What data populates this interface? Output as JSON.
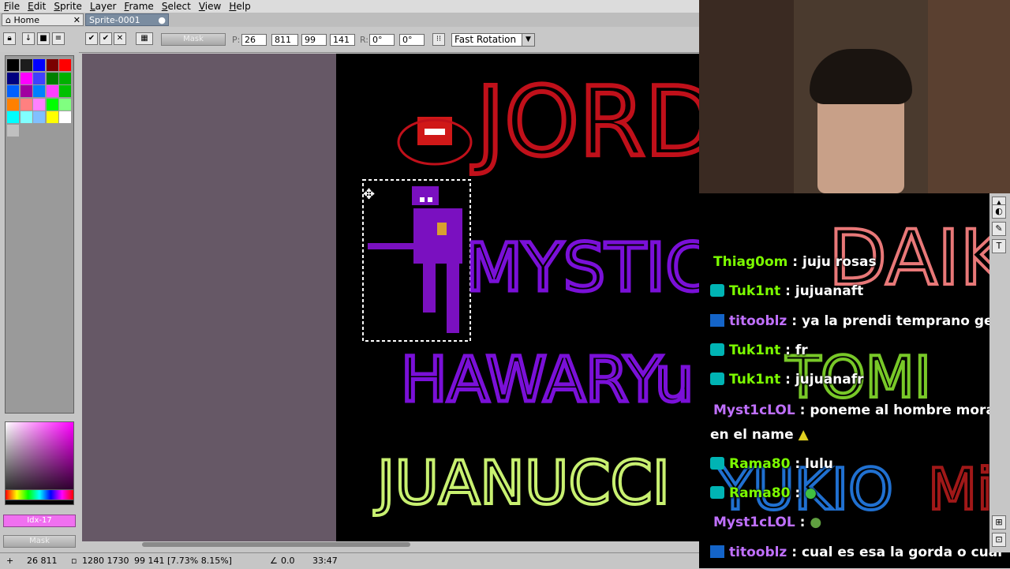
{
  "menu": [
    "File",
    "Edit",
    "Sprite",
    "Layer",
    "Frame",
    "Select",
    "View",
    "Help"
  ],
  "tabs": {
    "home": "Home",
    "sprite": "Sprite-0001"
  },
  "toolbar": {
    "mask_label": "Mask",
    "p_label": "P:",
    "x": "26",
    "y": "811",
    "w": "99",
    "h": "141",
    "r_label": "R:",
    "r1": "0°",
    "r2": "0°",
    "rotation": "Fast Rotation"
  },
  "palette": {
    "colors": [
      "#000000",
      "#1c1c1c",
      "#0000ff",
      "#7a0000",
      "#ff0000",
      "#000080",
      "#ff00ff",
      "#4040ff",
      "#008000",
      "#00b000",
      "#0060ff",
      "#a000a0",
      "#0080ff",
      "#ff40ff",
      "#00c000",
      "#ff8000",
      "#ff8080",
      "#ff80ff",
      "#00ff00",
      "#80ff80",
      "#00ffff",
      "#80ffff",
      "#80c0ff",
      "#ffff00",
      "#ffffff",
      "#c0c0c0"
    ]
  },
  "left": {
    "index_label": "Idx-17",
    "mask_label": "Mask"
  },
  "status": {
    "cursor": "26 811",
    "size": "1280 1730",
    "selection": "99 141 [7.73% 8.15%]",
    "angle": "0.0",
    "time": "33:47"
  },
  "canvas_text": {
    "name1": "JORD",
    "name2": "MYSTICLOL",
    "name3": "HAWARYu",
    "name4": "JUANUCCI",
    "name5": "DAIK",
    "name6": "TOMI",
    "name7": "YUKIO",
    "name8": "Mi"
  },
  "chat": [
    {
      "user": "Thiag0om",
      "badge": "",
      "color": "#7cfc00",
      "msg": "juju rosas"
    },
    {
      "user": "Tuk1nt",
      "badge": "mod",
      "color": "#7cfc00",
      "msg": "jujuanaft"
    },
    {
      "user": "titooblz",
      "badge": "vip",
      "color": "#c070ff",
      "msg": "ya la prendi temprano ged"
    },
    {
      "user": "Tuk1nt",
      "badge": "mod",
      "color": "#7cfc00",
      "msg": "fr"
    },
    {
      "user": "Tuk1nt",
      "badge": "mod",
      "color": "#7cfc00",
      "msg": "jujuanafr"
    },
    {
      "user": "Myst1cLOL",
      "badge": "",
      "color": "#c070ff",
      "msg": "poneme al hombre morado"
    },
    {
      "user": "",
      "badge": "",
      "color": "#ffffff",
      "msg": "en el name"
    },
    {
      "user": "Rama80",
      "badge": "mod",
      "color": "#7cfc00",
      "msg": "lulu"
    },
    {
      "user": "Rama80",
      "badge": "mod",
      "color": "#7cfc00",
      "msg": ""
    },
    {
      "user": "Myst1cLOL",
      "badge": "",
      "color": "#c070ff",
      "msg": ""
    },
    {
      "user": "titooblz",
      "badge": "vip",
      "color": "#c070ff",
      "msg": "cual es esa la gorda o cual"
    }
  ]
}
